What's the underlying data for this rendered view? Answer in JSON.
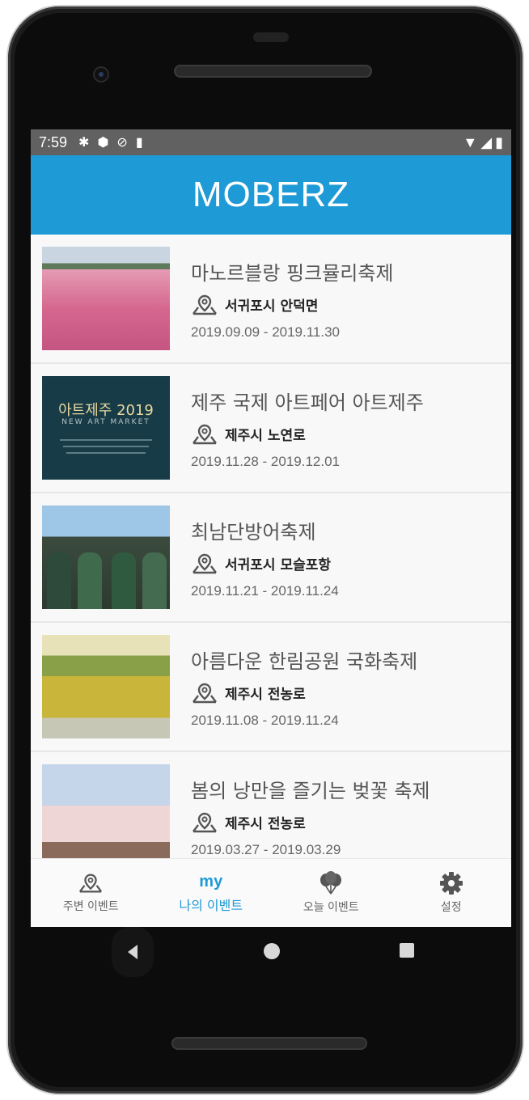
{
  "status_bar": {
    "time": "7:59"
  },
  "app": {
    "title": "MOBERZ"
  },
  "events": [
    {
      "name": "마노르블랑 핑크뮬리축제",
      "location": "서귀포시 안덕면",
      "dates": "2019.09.09 - 2019.11.30"
    },
    {
      "name": "제주 국제 아트페어 아트제주",
      "location": "제주시 노연로",
      "dates": "2019.11.28 - 2019.12.01",
      "poster_title": "아트제주 2019",
      "poster_subtitle": "NEW ART MARKET"
    },
    {
      "name": "최남단방어축제",
      "location": "서귀포시 모슬포항",
      "dates": "2019.11.21 - 2019.11.24"
    },
    {
      "name": "아름다운 한림공원 국화축제",
      "location": "제주시 전농로",
      "dates": "2019.11.08 - 2019.11.24"
    },
    {
      "name": "봄의 낭만을 즐기는 벚꽃 축제",
      "location": "제주시 전농로",
      "dates": "2019.03.27 - 2019.03.29"
    }
  ],
  "bottom_nav": {
    "nearby": {
      "label": "주변 이벤트",
      "icon": "location-pin-icon"
    },
    "my": {
      "label": "나의 이벤트",
      "icon_text": "my",
      "active": true
    },
    "today": {
      "label": "오늘 이벤트",
      "icon": "balloons-icon"
    },
    "settings": {
      "label": "설정",
      "icon": "gear-icon"
    }
  },
  "colors": {
    "primary": "#1e9ad6",
    "status_bar": "#616161"
  }
}
